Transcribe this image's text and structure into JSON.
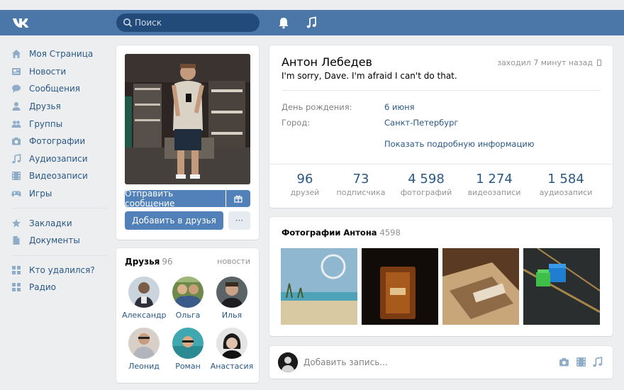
{
  "header": {
    "search_placeholder": "Поиск"
  },
  "menu": {
    "items": [
      {
        "label": "Моя Страница",
        "icon": "home-icon"
      },
      {
        "label": "Новости",
        "icon": "news-icon"
      },
      {
        "label": "Сообщения",
        "icon": "messages-icon"
      },
      {
        "label": "Друзья",
        "icon": "friends-icon"
      },
      {
        "label": "Группы",
        "icon": "groups-icon"
      },
      {
        "label": "Фотографии",
        "icon": "camera-icon"
      },
      {
        "label": "Аудиозаписи",
        "icon": "music-icon"
      },
      {
        "label": "Видеозаписи",
        "icon": "video-icon"
      },
      {
        "label": "Игры",
        "icon": "gamepad-icon"
      }
    ],
    "secondary": [
      {
        "label": "Закладки",
        "icon": "star-icon"
      },
      {
        "label": "Документы",
        "icon": "document-icon"
      }
    ],
    "apps": [
      {
        "label": "Кто удалился?",
        "icon": "app-grid-icon"
      },
      {
        "label": "Радио",
        "icon": "app-grid-icon"
      }
    ]
  },
  "actions": {
    "send_message": "Отправить сообщение",
    "add_friend": "Добавить в друзья",
    "more": "···"
  },
  "friends": {
    "title": "Друзья",
    "count": "96",
    "link": "новости",
    "list": [
      {
        "name": "Александр"
      },
      {
        "name": "Ольга"
      },
      {
        "name": "Илья"
      },
      {
        "name": "Леонид"
      },
      {
        "name": "Роман"
      },
      {
        "name": "Анастасия"
      }
    ]
  },
  "profile": {
    "name": "Антон Лебедев",
    "last_seen": "заходил 7 минут назад",
    "status": "I'm sorry, Dave. I'm afraid I can't do that.",
    "birthday_label": "День рождения:",
    "birthday_value": "6 июня",
    "city_label": "Город:",
    "city_value": "Санкт-Петербург",
    "more_info": "Показать подробную информацию"
  },
  "counters": [
    {
      "value": "96",
      "label": "друзей"
    },
    {
      "value": "73",
      "label": "подписчика"
    },
    {
      "value": "4 598",
      "label": "фотографий"
    },
    {
      "value": "1 274",
      "label": "видеозаписи"
    },
    {
      "value": "1 584",
      "label": "аудиозаписи"
    }
  ],
  "photos": {
    "title": "Фотографии Антона",
    "count": "4598"
  },
  "post": {
    "placeholder": "Добавить запись..."
  },
  "colors": {
    "header": "#4a76a8",
    "accent": "#5181b8",
    "link": "#2a5885",
    "background": "#edeef0"
  }
}
